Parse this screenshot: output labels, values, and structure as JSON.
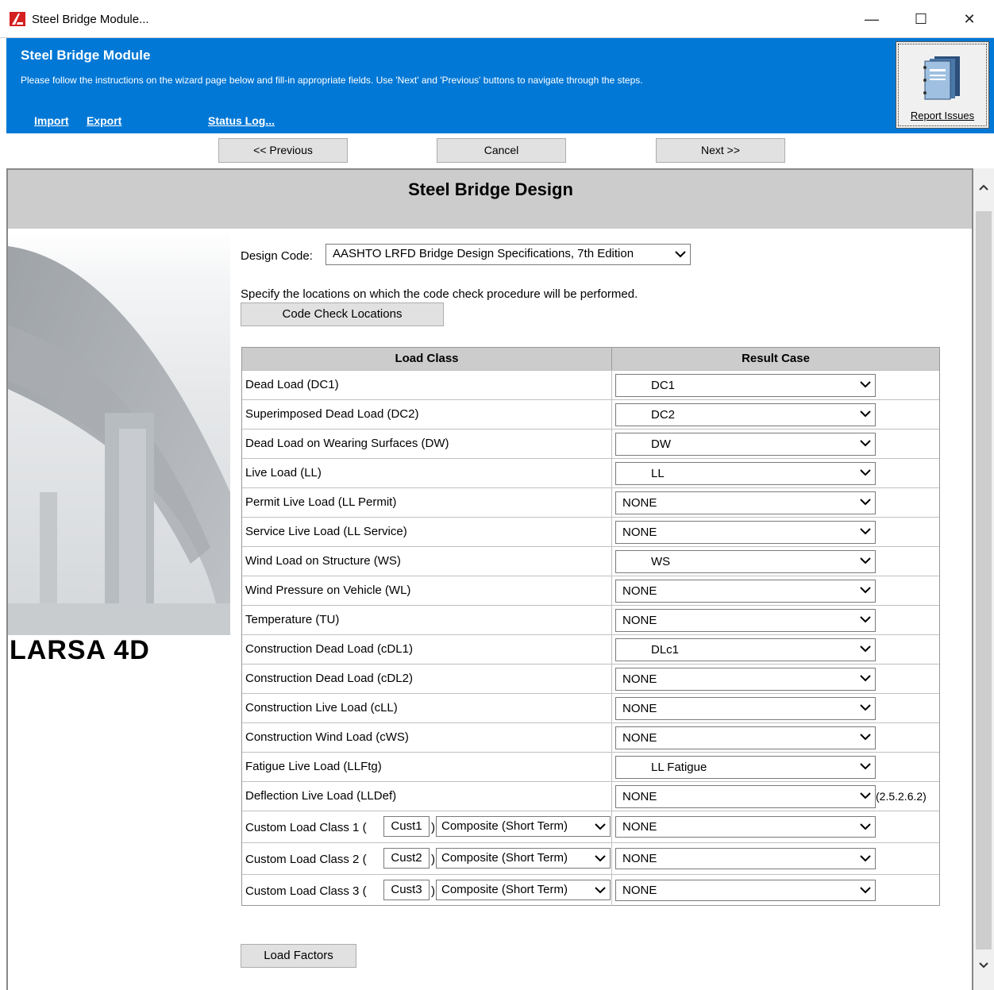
{
  "window": {
    "title": "Steel Bridge Module...",
    "minimize": "—",
    "maximize": "☐",
    "close": "✕"
  },
  "banner": {
    "title": "Steel Bridge Module",
    "description": "Please follow the instructions on the wizard page below and fill-in appropriate fields. Use 'Next' and 'Previous' buttons to navigate through the steps.",
    "links": {
      "import": "Import",
      "export": "Export",
      "status_log": "Status Log..."
    },
    "report_issues": "Report Issues"
  },
  "nav": {
    "previous": "<< Previous",
    "cancel": "Cancel",
    "next": "Next >>"
  },
  "page": {
    "title": "Steel Bridge Design",
    "logo_text": "LARSA 4D",
    "design_code_label": "Design Code:",
    "design_code_value": "AASHTO LRFD Bridge Design Specifications, 7th Edition",
    "instruction": "Specify the locations on which the code check procedure will be performed.",
    "code_check_button": "Code Check Locations",
    "load_factors_button": "Load Factors"
  },
  "table": {
    "headers": {
      "load_class": "Load Class",
      "result_case": "Result Case"
    },
    "rows": [
      {
        "load_class": "Dead Load (DC1)",
        "result_case": "DC1"
      },
      {
        "load_class": "Superimposed Dead Load (DC2)",
        "result_case": "DC2"
      },
      {
        "load_class": "Dead Load on Wearing Surfaces (DW)",
        "result_case": "DW"
      },
      {
        "load_class": "Live Load (LL)",
        "result_case": "LL"
      },
      {
        "load_class": "Permit Live Load (LL Permit)",
        "result_case": "NONE"
      },
      {
        "load_class": "Service Live Load (LL Service)",
        "result_case": "NONE"
      },
      {
        "load_class": "Wind Load on Structure (WS)",
        "result_case": "WS"
      },
      {
        "load_class": "Wind Pressure on Vehicle (WL)",
        "result_case": "NONE"
      },
      {
        "load_class": "Temperature (TU)",
        "result_case": "NONE"
      },
      {
        "load_class": "Construction Dead Load (cDL1)",
        "result_case": "DLc1"
      },
      {
        "load_class": "Construction Dead Load (cDL2)",
        "result_case": "NONE"
      },
      {
        "load_class": "Construction Live Load (cLL)",
        "result_case": "NONE"
      },
      {
        "load_class": "Construction Wind Load (cWS)",
        "result_case": "NONE"
      },
      {
        "load_class": "Fatigue Live Load (LLFtg)",
        "result_case": "LL Fatigue"
      },
      {
        "load_class": "Deflection Live Load (LLDef)",
        "result_case": "NONE",
        "note": "(2.5.2.6.2)"
      }
    ],
    "custom_rows": [
      {
        "prefix": "Custom Load Class 1 (",
        "name": "Cust1",
        "suffix": ")",
        "type": "Composite (Short Term)",
        "result_case": "NONE"
      },
      {
        "prefix": "Custom Load Class 2 (",
        "name": "Cust2",
        "suffix": ")",
        "type": "Composite (Short Term)",
        "result_case": "NONE"
      },
      {
        "prefix": "Custom Load Class 3 (",
        "name": "Cust3",
        "suffix": ")",
        "type": "Composite (Short Term)",
        "result_case": "NONE"
      }
    ]
  }
}
